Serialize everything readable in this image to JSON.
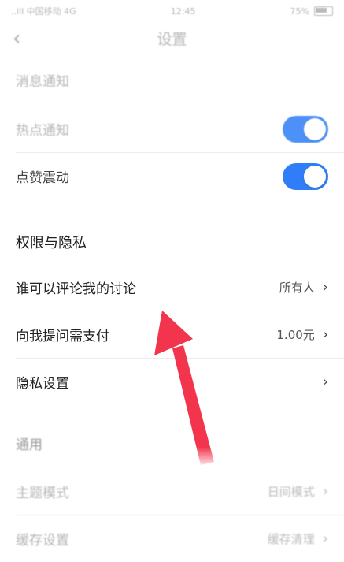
{
  "status_bar": {
    "carrier": "..ill 中国移动 4G",
    "time": "12:45",
    "battery": "75%"
  },
  "nav": {
    "back_glyph": "‹",
    "title": "设置"
  },
  "messages": {
    "header": "消息通知",
    "items": [
      {
        "label": "热点通知",
        "toggle_on": true
      },
      {
        "label": "点赞震动",
        "toggle_on": true
      }
    ]
  },
  "privacy": {
    "header": "权限与隐私",
    "items": [
      {
        "label": "谁可以评论我的讨论",
        "value": "所有人",
        "chevron": "›"
      },
      {
        "label": "向我提问需支付",
        "value": "1.00元",
        "chevron": "›"
      },
      {
        "label": "隐私设置",
        "value": "",
        "chevron": "›"
      }
    ]
  },
  "general": {
    "header": "通用",
    "items": [
      {
        "label": "主题模式",
        "value": "日间模式",
        "chevron": "›"
      },
      {
        "label": "缓存设置",
        "value": "缓存清理",
        "chevron": "›"
      }
    ]
  },
  "annotation": {
    "arrow_color": "#f2344d",
    "icon": "red-arrow-pointing-up"
  },
  "accent_color": "#2f7ef7"
}
